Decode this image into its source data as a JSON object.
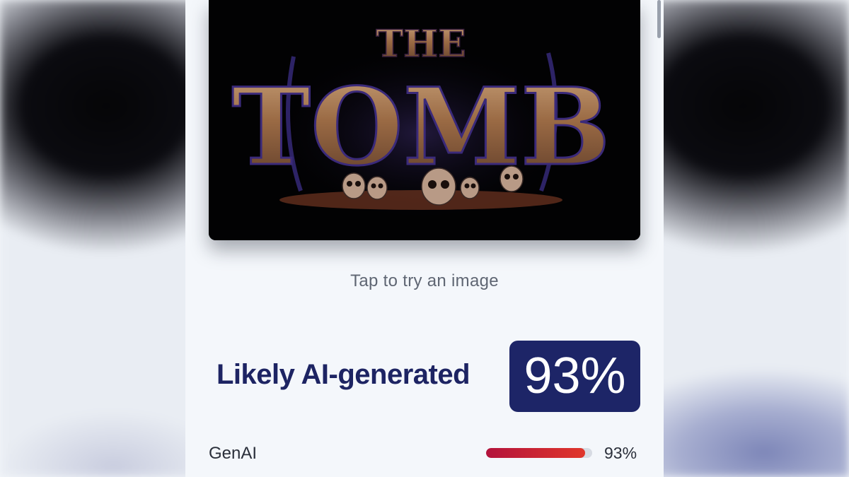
{
  "preview": {
    "title_small": "THE",
    "title_large": "TOMB"
  },
  "hint_text": "Tap to try an image",
  "result": {
    "verdict": "Likely AI-generated",
    "score_text": "93%"
  },
  "categories": [
    {
      "label": "GenAI",
      "value_text": "93%",
      "fraction": 0.93
    }
  ],
  "colors": {
    "accent_navy": "#1d2567",
    "bar_red": "#d0222f"
  }
}
